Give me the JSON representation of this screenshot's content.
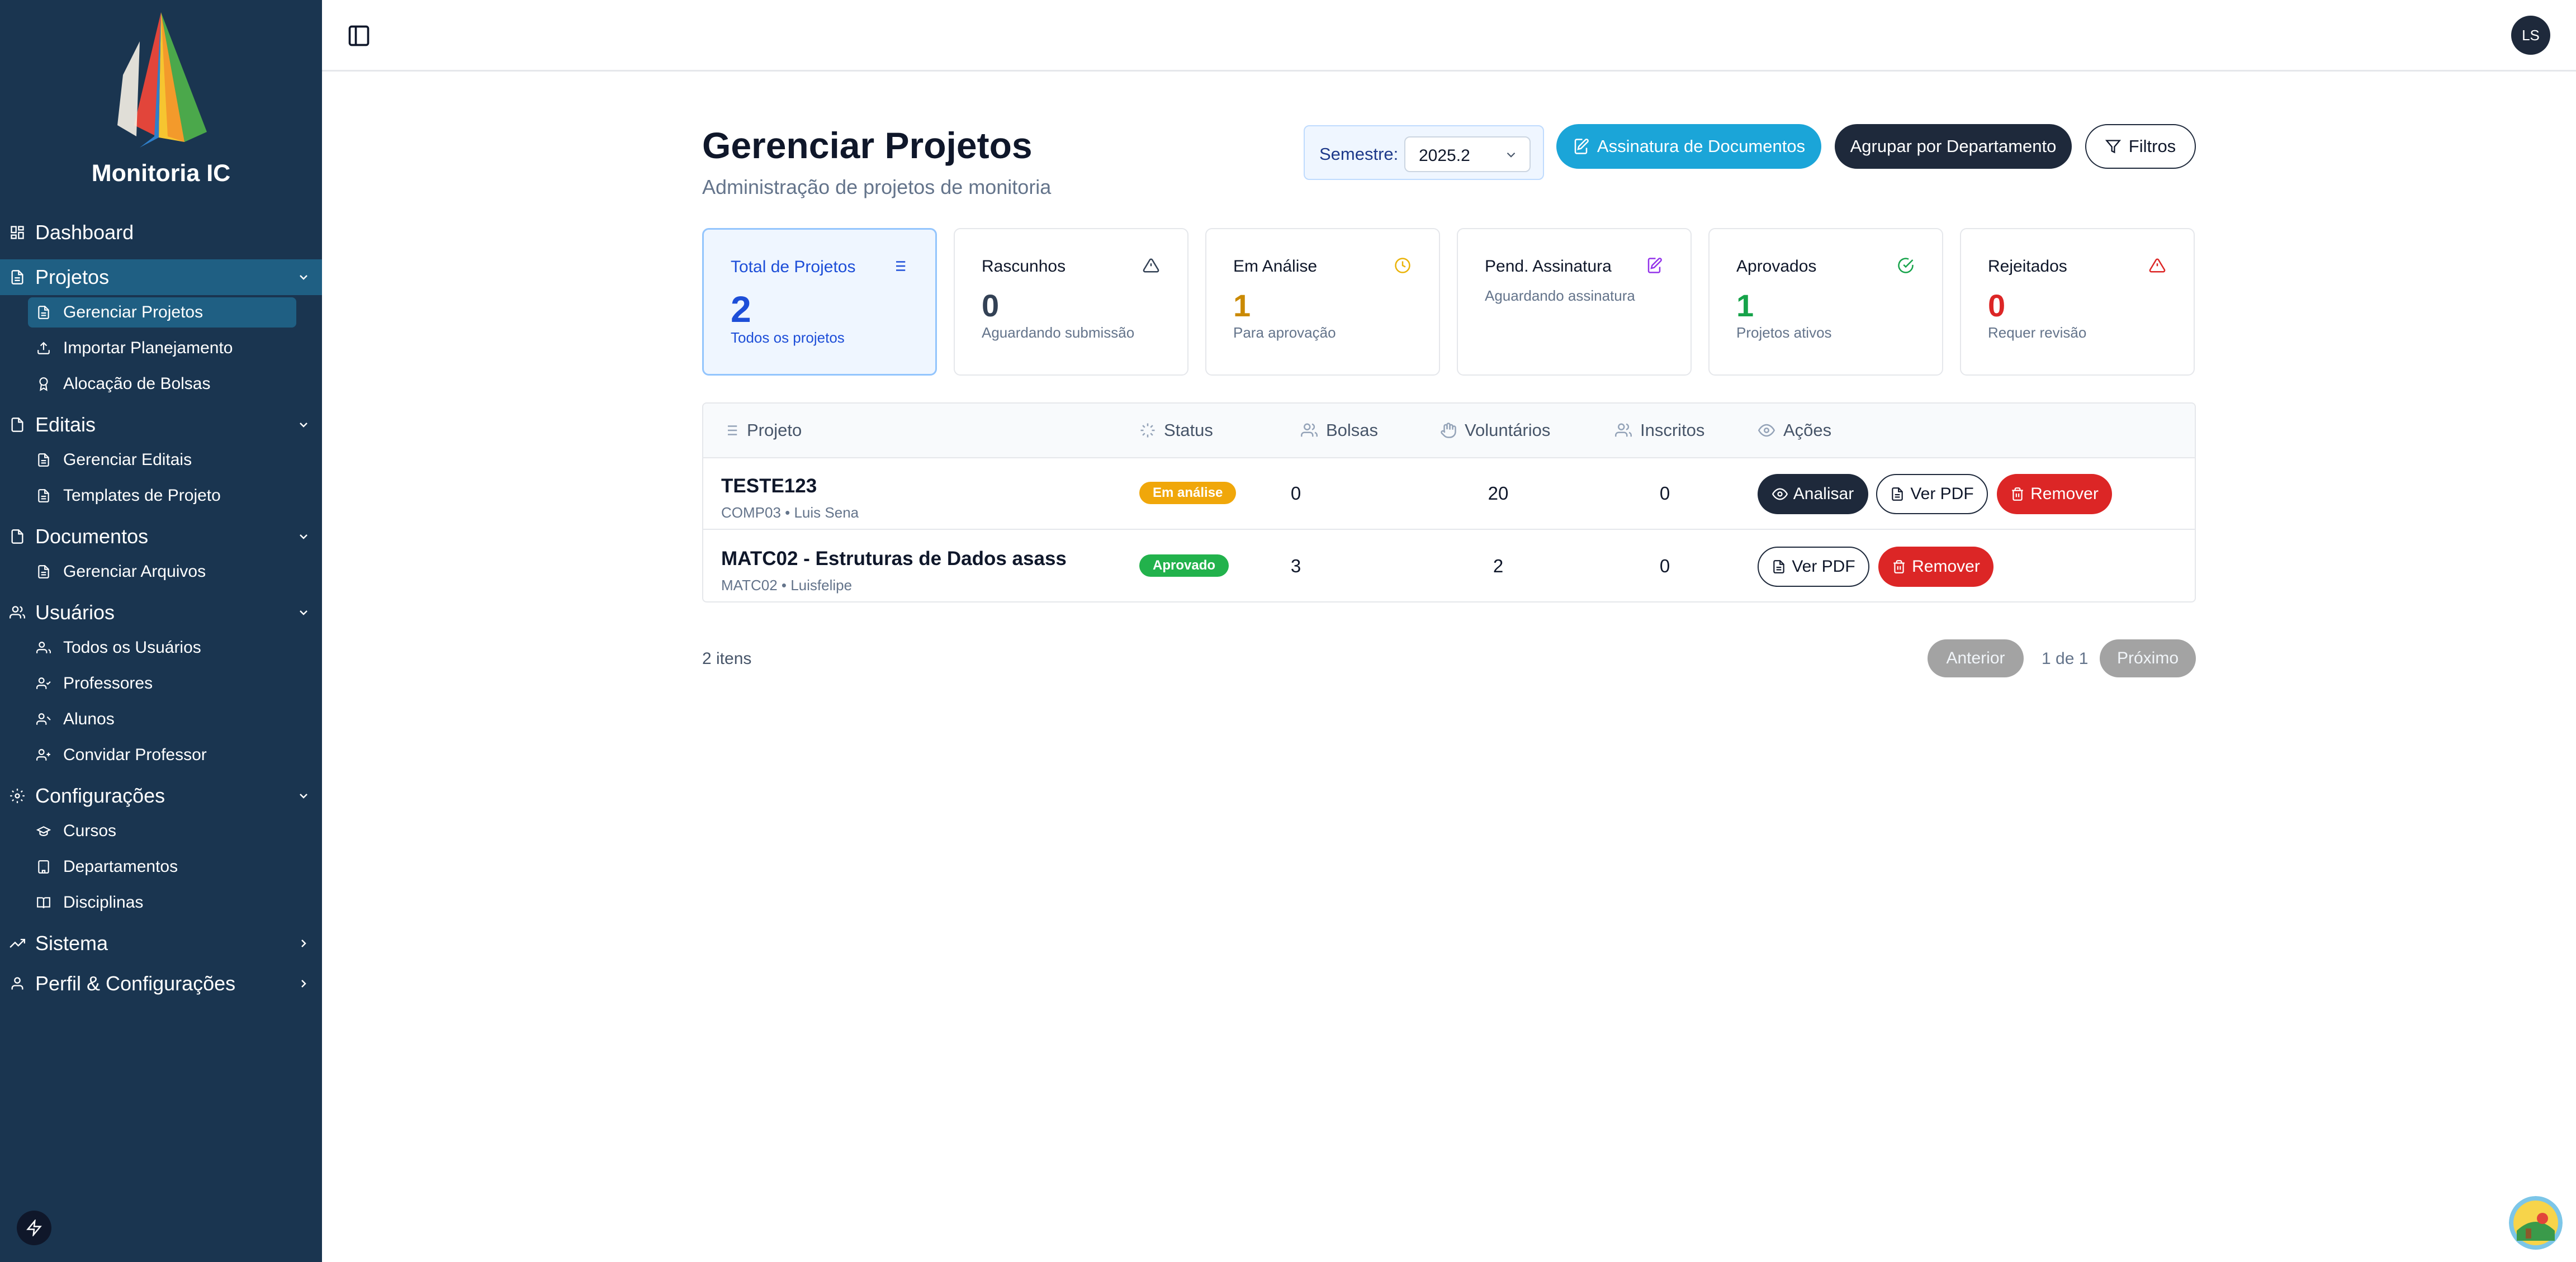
{
  "app": {
    "name": "Monitoria IC",
    "user_initials": "LS"
  },
  "sidebar": {
    "dashboard": "Dashboard",
    "projetos": {
      "label": "Projetos",
      "items": [
        "Gerenciar Projetos",
        "Importar Planejamento",
        "Alocação de Bolsas"
      ]
    },
    "editais": {
      "label": "Editais",
      "items": [
        "Gerenciar Editais",
        "Templates de Projeto"
      ]
    },
    "documentos": {
      "label": "Documentos",
      "items": [
        "Gerenciar Arquivos"
      ]
    },
    "usuarios": {
      "label": "Usuários",
      "items": [
        "Todos os Usuários",
        "Professores",
        "Alunos",
        "Convidar Professor"
      ]
    },
    "configuracoes": {
      "label": "Configurações",
      "items": [
        "Cursos",
        "Departamentos",
        "Disciplinas"
      ]
    },
    "sistema": "Sistema",
    "perfil": "Perfil & Configurações"
  },
  "header": {
    "title": "Gerenciar Projetos",
    "subtitle": "Administração de projetos de monitoria",
    "semester_label": "Semestre:",
    "semester_value": "2025.2",
    "btn_sign": "Assinatura de Documentos",
    "btn_group": "Agrupar por Departamento",
    "btn_filter": "Filtros"
  },
  "stats": [
    {
      "title": "Total de Projetos",
      "value": "2",
      "note": "Todos os projetos",
      "color": "#1d4ed8",
      "icon": "list-icon"
    },
    {
      "title": "Rascunhos",
      "value": "0",
      "note": "Aguardando submissão",
      "color": "#334155",
      "icon": "warning-icon"
    },
    {
      "title": "Em Análise",
      "value": "1",
      "note": "Para aprovação",
      "color": "#ca8a04",
      "icon": "clock-icon"
    },
    {
      "title": "Pend. Assinatura",
      "value": "",
      "note": "Aguardando assinatura",
      "color": "#9333ea",
      "icon": "sign-icon"
    },
    {
      "title": "Aprovados",
      "value": "1",
      "note": "Projetos ativos",
      "color": "#16a34a",
      "icon": "check-circle-icon"
    },
    {
      "title": "Rejeitados",
      "value": "0",
      "note": "Requer revisão",
      "color": "#dc2626",
      "icon": "alert-triangle-icon"
    }
  ],
  "table": {
    "headers": [
      "Projeto",
      "Status",
      "Bolsas",
      "Voluntários",
      "Inscritos",
      "Ações"
    ],
    "rows": [
      {
        "name": "TESTE123",
        "sub": "COMP03 • Luis Sena",
        "status": "Em análise",
        "bolsas": "0",
        "voluntarios": "20",
        "inscritos": "0",
        "actions": [
          "Analisar",
          "Ver PDF",
          "Remover"
        ]
      },
      {
        "name": "MATC02 - Estruturas de Dados asass",
        "sub": "MATC02 • Luisfelipe",
        "status": "Aprovado",
        "bolsas": "3",
        "voluntarios": "2",
        "inscritos": "0",
        "actions": [
          "Ver PDF",
          "Remover"
        ]
      }
    ]
  },
  "footer": {
    "count": "2 itens",
    "prev": "Anterior",
    "page_info": "1 de 1",
    "next": "Próximo"
  }
}
